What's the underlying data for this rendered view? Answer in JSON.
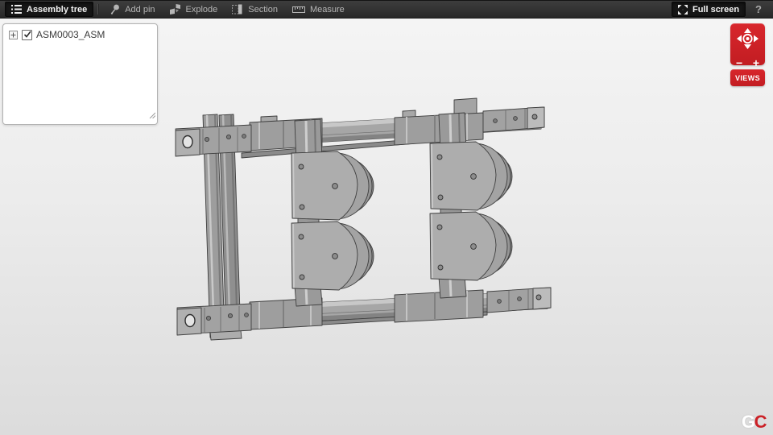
{
  "toolbar": {
    "assembly_tree_label": "Assembly tree",
    "add_pin_label": "Add pin",
    "explode_label": "Explode",
    "section_label": "Section",
    "measure_label": "Measure",
    "full_screen_label": "Full screen",
    "help_label": "?"
  },
  "assembly_tree_panel": {
    "root_node": {
      "label": "ASM0003_ASM",
      "checked": true,
      "expandable": true
    }
  },
  "view_controls": {
    "zoom_out_label": "−",
    "zoom_in_label": "+",
    "views_button_label": "VIEWS"
  },
  "watermark": {
    "letter_g": "G",
    "letter_c": "C"
  },
  "icons": {
    "assembly_tree": "tree-list-icon",
    "add_pin": "pin-icon",
    "explode": "explode-cube-icon",
    "section": "section-plane-icon",
    "measure": "ruler-icon",
    "full_screen": "expand-arrows-icon",
    "pan": "dpad-icon"
  },
  "colors": {
    "accent_red": "#cb2127",
    "toolbar_bg": "#323232",
    "canvas_top": "#f5f5f5",
    "canvas_bottom": "#dcdcdc",
    "model_gray": "#a6a6a6"
  }
}
